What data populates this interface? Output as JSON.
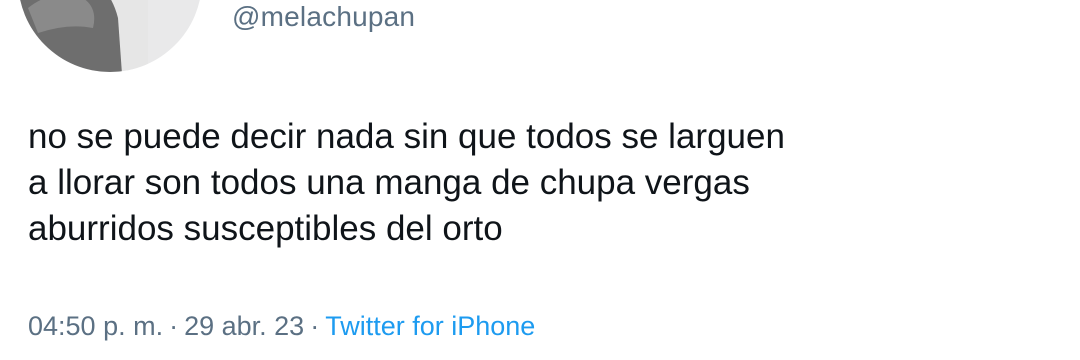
{
  "author": {
    "handle": "@melachupan"
  },
  "tweet": {
    "lines": [
      "no se puede decir nada sin que todos se larguen",
      "a llorar son todos una manga de chupa vergas",
      "aburridos susceptibles del orto"
    ]
  },
  "meta": {
    "time": "04:50 p. m.",
    "separator": "·",
    "date": "29 abr. 23",
    "source": "Twitter for iPhone"
  },
  "colors": {
    "text": "#0f1419",
    "muted": "#5b7083",
    "link": "#1d9bf0"
  }
}
